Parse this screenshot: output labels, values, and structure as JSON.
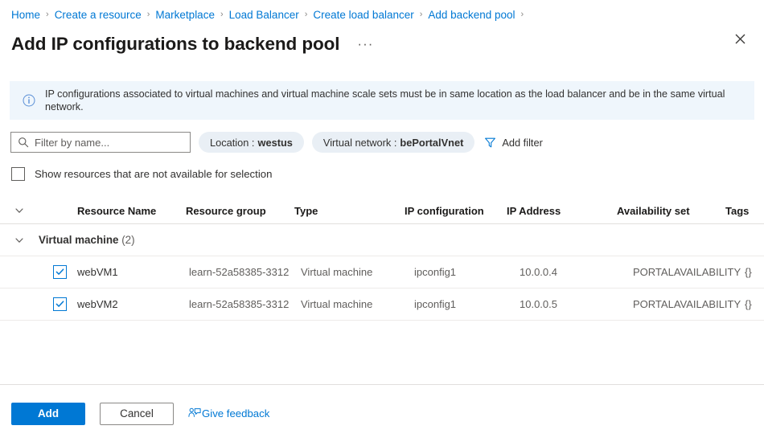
{
  "breadcrumb": {
    "separator": "›",
    "items": [
      {
        "label": "Home"
      },
      {
        "label": "Create a resource"
      },
      {
        "label": "Marketplace"
      },
      {
        "label": "Load Balancer"
      },
      {
        "label": "Create load balancer"
      },
      {
        "label": "Add backend pool"
      }
    ]
  },
  "header": {
    "title": "Add IP configurations to backend pool",
    "ellipsis": "···",
    "close_icon": "close-icon"
  },
  "info_banner": {
    "icon": "info-circle-icon",
    "text": "IP configurations associated to virtual machines and virtual machine scale sets must be in same location as the load balancer and be in the same virtual network.",
    "background": "#eff6fc"
  },
  "filter_bar": {
    "search": {
      "placeholder": "Filter by name...",
      "value": "",
      "icon": "search-icon"
    },
    "pills": [
      {
        "label": "Location :",
        "value": "westus"
      },
      {
        "label": "Virtual network :",
        "value": "bePortalVnet"
      }
    ],
    "add_filter": {
      "label": "Add filter",
      "icon": "funnel-icon"
    }
  },
  "show_unavailable": {
    "label": "Show resources that are not available for selection",
    "checked": false
  },
  "table": {
    "columns": [
      {
        "key": "name",
        "label": "Resource Name"
      },
      {
        "key": "resource_group",
        "label": "Resource group"
      },
      {
        "key": "type",
        "label": "Type"
      },
      {
        "key": "ip_configuration",
        "label": "IP configuration"
      },
      {
        "key": "ip_address",
        "label": "IP Address"
      },
      {
        "key": "availability_set",
        "label": "Availability set"
      },
      {
        "key": "tags",
        "label": "Tags"
      }
    ],
    "group": {
      "label": "Virtual machine",
      "count": "(2)",
      "expanded": true
    },
    "rows": [
      {
        "selected": true,
        "name": "webVM1",
        "resource_group": "learn-52a58385-3312",
        "type": "Virtual machine",
        "ip_configuration": "ipconfig1",
        "ip_address": "10.0.0.4",
        "availability_set": "PORTALAVAILABILITY",
        "tags": "{}"
      },
      {
        "selected": true,
        "name": "webVM2",
        "resource_group": "learn-52a58385-3312",
        "type": "Virtual machine",
        "ip_configuration": "ipconfig1",
        "ip_address": "10.0.0.5",
        "availability_set": "PORTALAVAILABILITY",
        "tags": "{}"
      }
    ]
  },
  "footer": {
    "add_label": "Add",
    "cancel_label": "Cancel",
    "feedback_label": "Give feedback",
    "feedback_icon": "feedback-person-icon"
  },
  "colors": {
    "accent": "#0078d4",
    "link": "#0078d4",
    "banner_bg": "#eff6fc",
    "pill_bg": "#e9eff5",
    "text": "#323130",
    "muted_text": "#605e5c"
  }
}
